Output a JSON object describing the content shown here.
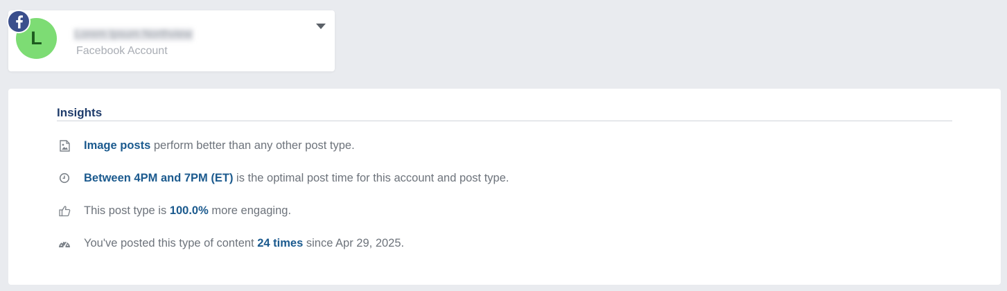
{
  "account": {
    "avatar_letter": "L",
    "name": "Lorem Ipsum Northview",
    "type": "Facebook Account",
    "network_icon": "facebook-icon"
  },
  "insights": {
    "title": "Insights",
    "rows": [
      {
        "icon": "image-icon",
        "highlight": "Image posts",
        "text_after": " perform better than any other post type."
      },
      {
        "icon": "clock-icon",
        "highlight": "Between 4PM and 7PM (ET)",
        "text_after": " is the optimal post time for this account and post type."
      },
      {
        "icon": "thumbs-up-icon",
        "text_before": "This post type is ",
        "highlight": "100.0%",
        "text_after": " more engaging."
      },
      {
        "icon": "gauge-icon",
        "text_before": "You've posted this type of content ",
        "highlight": "24 times",
        "text_after": " since Apr 29, 2025."
      }
    ]
  },
  "colors": {
    "accent": "#1b5a8e",
    "title": "#1f3c6b",
    "avatar": "#7ddc74",
    "facebook": "#3b4f8c",
    "background": "#e9ebef"
  }
}
